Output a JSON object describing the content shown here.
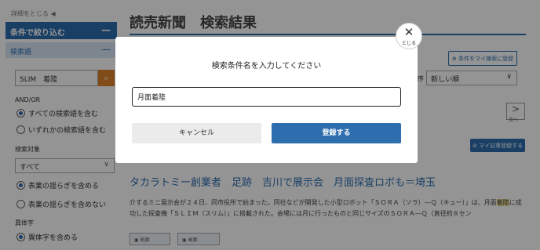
{
  "sidebar": {
    "collapse_label": "詳細をとじる ◀",
    "filter_header": "条件で絞り込む",
    "keyword_header": "検索語",
    "collapse_symbol": "—",
    "keyword_value": "SLIM　着陸",
    "andor_label": "AND/OR",
    "andor_options": [
      "すべての検索語を含む",
      "いずれかの検索語を含む"
    ],
    "target_label": "検索対象",
    "target_select": "すべて",
    "variation_options": [
      "表業の揺らぎを含める",
      "表業の揺らぎを含めない"
    ],
    "variant_label": "異体字",
    "variant_option": "異体字を含める"
  },
  "main": {
    "title": "読売新聞　検索結果",
    "register_condition_button": "条件をマイ検索に登録",
    "sort_label": "序",
    "sort_value": "新しい順",
    "next_label": "次へ",
    "register_article_button": "マイ記事登録する",
    "headline": "タカラトミー創業者　足跡　吉川で展示会　月面探査ロボも＝埼玉",
    "snippet_before": "介するミニ展示会が２４日、同市役所で始まった。同社などが開発した小型ロボット「ＳＯＲＡ（ソラ）―Ｑ（キュー）」は、月面",
    "snippet_highlight": "着陸",
    "snippet_after": "に成功した探査機「ＳＬＩＭ（スリム）」に搭載された。会場には月に行ったものと同じサイズのＳＯＲＡ―Ｑ（直径約８セン",
    "small_buttons": [
      "紙面",
      "画面"
    ]
  },
  "modal": {
    "title": "検索条件名を入力してください",
    "input_value": "月面着陸",
    "cancel_label": "キャンセル",
    "register_label": "登録する",
    "close_symbol": "✕",
    "close_label": "とじる"
  },
  "colors": {
    "primary": "#2e6dae",
    "accent": "#e0842a",
    "overlay": "rgba(0,0,0,0.42)"
  }
}
